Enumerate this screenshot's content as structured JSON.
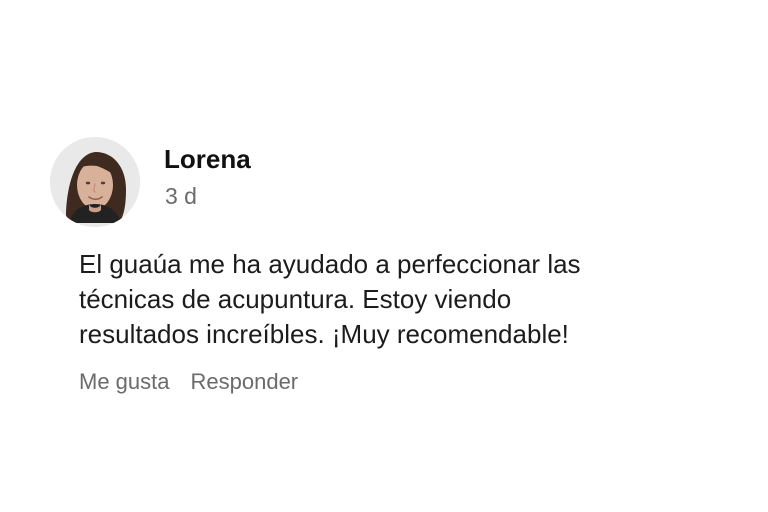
{
  "comment": {
    "author": "Lorena",
    "timestamp": "3 d",
    "text_lines": [
      "El guaúa me ha ayudado a perfeccionar las",
      "técnicas de acupuntura. Estoy viendo",
      "resultados increíbles. ¡Muy recomendable!"
    ],
    "actions": {
      "like_label": "Me gusta",
      "reply_label": "Responder"
    }
  },
  "colors": {
    "name": "#111111",
    "secondary_text": "#6b6b6b",
    "body_text": "#1c1c1e",
    "background": "#ffffff"
  },
  "icons": {
    "avatar": "user-avatar-photo"
  }
}
